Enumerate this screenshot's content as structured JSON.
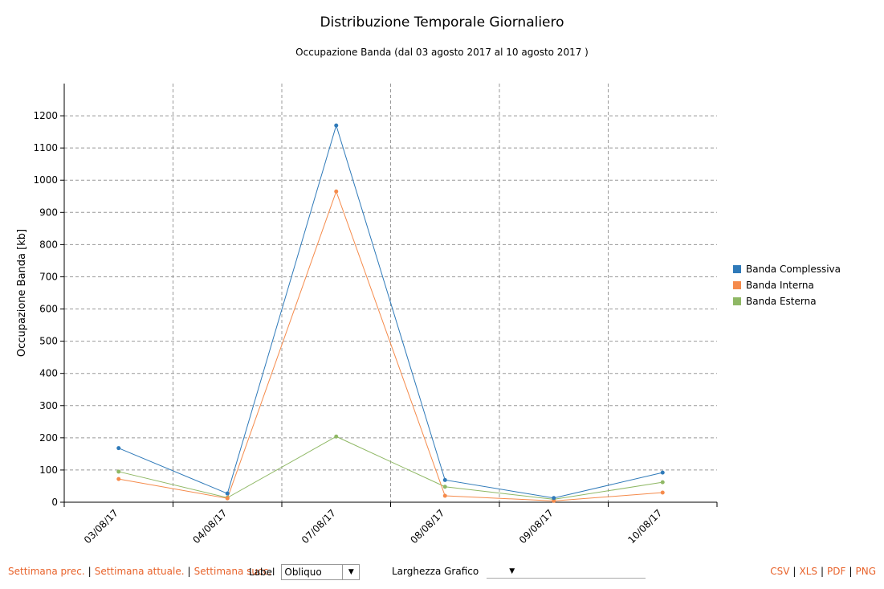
{
  "chart_data": {
    "type": "line",
    "title": "Distribuzione Temporale Giornaliero",
    "subtitle": "Occupazione Banda (dal 03 agosto 2017 al 10 agosto 2017 )",
    "xlabel": "",
    "ylabel": "Occupazione Banda [kb]",
    "ylim": [
      0,
      1300
    ],
    "yticks": [
      0,
      100,
      200,
      300,
      400,
      500,
      600,
      700,
      800,
      900,
      1000,
      1100,
      1200
    ],
    "grid": true,
    "legend_position": "right",
    "categories": [
      "03/08/17",
      "04/08/17",
      "07/08/17",
      "08/08/17",
      "09/08/17",
      "10/08/17"
    ],
    "series": [
      {
        "name": "Banda Complessiva",
        "color": "#2f7ab9",
        "values": [
          168,
          27,
          1170,
          69,
          13,
          92
        ]
      },
      {
        "name": "Banda Interna",
        "color": "#f58b4c",
        "values": [
          72,
          12,
          965,
          20,
          4,
          30
        ]
      },
      {
        "name": "Banda Esterna",
        "color": "#8fb865",
        "values": [
          95,
          14,
          204,
          48,
          9,
          62
        ]
      }
    ]
  },
  "footer": {
    "prev_week": "Settimana prec.",
    "current_week": "Settimana attuale.",
    "next_week": "Settimana succ.",
    "label_text": "Label",
    "label_value": "Obliquo",
    "width_text": "Larghezza Grafico",
    "exports": [
      "CSV",
      "XLS",
      "PDF",
      "PNG"
    ]
  }
}
